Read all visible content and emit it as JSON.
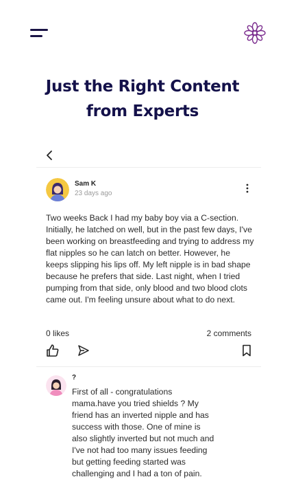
{
  "header": {
    "menu_icon": "hamburger-icon",
    "logo_icon": "flower-logo-icon",
    "brand_color": "#1a1446",
    "logo_color": "#7b2d8e"
  },
  "hero": {
    "title_line1": "Just the Right Content",
    "title_line2": "from Experts"
  },
  "post": {
    "author": "Sam K",
    "time_ago": "23 days ago",
    "body": "Two weeks Back I had my baby boy via a C-section. Initially, he latched on well, but in the past few days, I've been working on breastfeeding and trying to address my flat nipples so he can latch on better. However, he keeps slipping his lips off. My left nipple is in bad shape because he prefers that side. Last night, when I tried pumping from that side, only blood and two blood clots came out. I'm feeling unsure about what to do next.",
    "likes": "0 likes",
    "comments": "2 comments"
  },
  "comment": {
    "author": "?",
    "text": "First of all - congratulations mama.have you tried shields ? My friend has an inverted nipple and has success with those. One of mine is also slightly inverted but not much and I've not had too many issues feeding but getting feeding started was challenging and I had a ton of pain."
  }
}
